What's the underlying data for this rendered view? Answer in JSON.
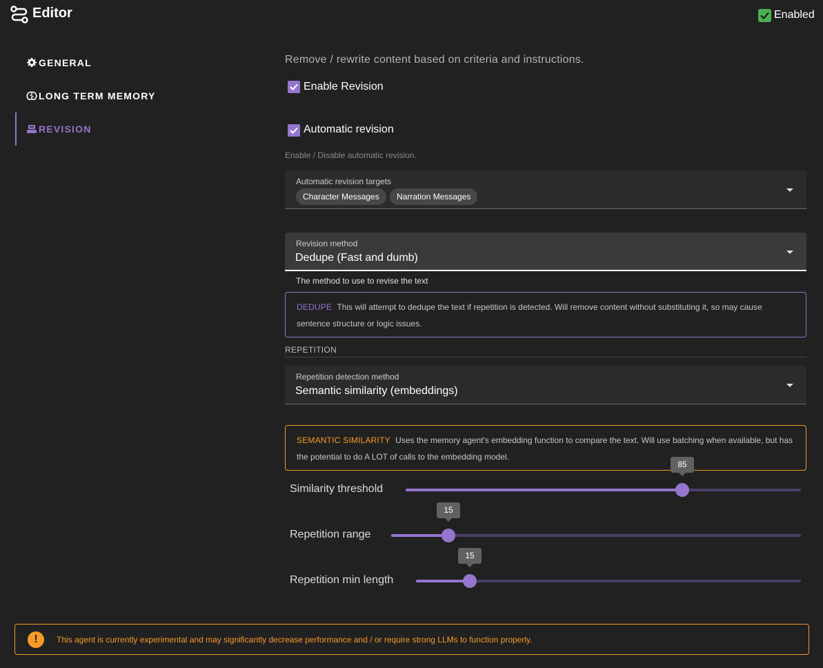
{
  "header": {
    "title": "Editor",
    "enabled_label": "Enabled",
    "enabled_checked": true
  },
  "sidebar": {
    "items": [
      {
        "label": "GENERAL",
        "icon": "gear-icon",
        "active": false
      },
      {
        "label": "LONG TERM MEMORY",
        "icon": "brain-icon",
        "active": false
      },
      {
        "label": "REVISION",
        "icon": "revision-icon",
        "active": true
      }
    ]
  },
  "main": {
    "description": "Remove / rewrite content based on criteria and instructions.",
    "enable_revision": {
      "label": "Enable Revision",
      "checked": true
    },
    "automatic_revision": {
      "label": "Automatic revision",
      "checked": true,
      "hint": "Enable / Disable automatic revision."
    },
    "targets": {
      "label": "Automatic revision targets",
      "chips": [
        "Character Messages",
        "Narration Messages"
      ]
    },
    "revision_method": {
      "label": "Revision method",
      "value": "Dedupe (Fast and dumb)",
      "hint": "The method to use to revise the text"
    },
    "dedupe_info": {
      "tag": "DEDUPE",
      "text": "This will attempt to dedupe the text if repetition is detected. Will remove content without substituting it, so may cause sentence structure or logic issues."
    },
    "repetition_section": "REPETITION",
    "detection_method": {
      "label": "Repetition detection method",
      "value": "Semantic similarity (embeddings)"
    },
    "semantic_info": {
      "tag": "SEMANTIC SIMILARITY",
      "text": "Uses the memory agent's embedding function to compare the text. Will use batching when available, but has the potential to do A LOT of calls to the embedding model."
    },
    "sliders": [
      {
        "label": "Similarity threshold",
        "value": "85",
        "fraction": 0.7
      },
      {
        "label": "Repetition range",
        "value": "15",
        "fraction": 0.14
      },
      {
        "label": "Repetition min length",
        "value": "15",
        "fraction": 0.14
      }
    ]
  },
  "warning": {
    "icon": "exclamation-icon",
    "text": "This agent is currently experimental and may significantly decrease performance and / or require strong LLMs to function properly."
  },
  "colors": {
    "background": "#212121",
    "accent": "#9575cd",
    "warning": "#f59a28",
    "enabled": "#4caf50"
  }
}
